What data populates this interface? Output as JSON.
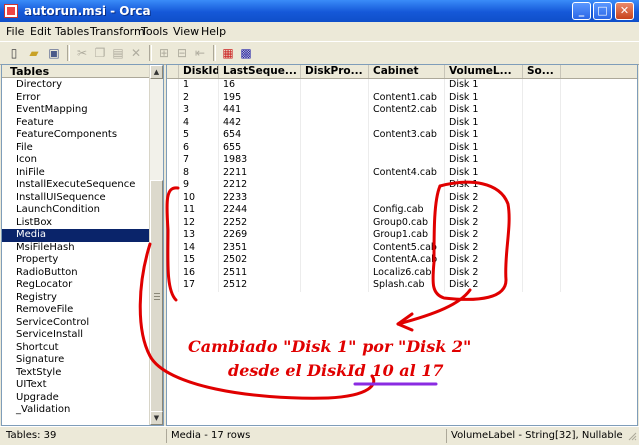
{
  "window": {
    "title": "autorun.msi - Orca"
  },
  "menu": [
    "File",
    "Edit",
    "Tables",
    "Transform",
    "Tools",
    "View",
    "Help"
  ],
  "toolbar_icons": [
    "new-icon",
    "open-icon",
    "save-icon",
    "cut-icon",
    "copy-icon",
    "paste-icon",
    "delete-icon",
    "add-row-icon",
    "drop-table-icon",
    "import-icon",
    "export-icon",
    "validate-icon",
    "merge-module-icon"
  ],
  "tables_pane": {
    "header": "Tables",
    "selected": "Media",
    "items": [
      "Directory",
      "Error",
      "EventMapping",
      "Feature",
      "FeatureComponents",
      "File",
      "Icon",
      "IniFile",
      "InstallExecuteSequence",
      "InstallUISequence",
      "LaunchCondition",
      "ListBox",
      "Media",
      "MsiFileHash",
      "Property",
      "RadioButton",
      "RegLocator",
      "Registry",
      "RemoveFile",
      "ServiceControl",
      "ServiceInstall",
      "Shortcut",
      "Signature",
      "TextStyle",
      "UIText",
      "Upgrade",
      "_Validation"
    ]
  },
  "grid": {
    "columns": [
      "DiskId",
      "LastSequence",
      "DiskPrompt",
      "Cabinet",
      "VolumeLabel",
      "Source"
    ],
    "columns_display": [
      "DiskId",
      "LastSeque...",
      "DiskPro...",
      "Cabinet",
      "VolumeL...",
      "So..."
    ],
    "rows": [
      [
        "1",
        "16",
        "",
        "",
        "Disk 1",
        ""
      ],
      [
        "2",
        "195",
        "",
        "Content1.cab",
        "Disk 1",
        ""
      ],
      [
        "3",
        "441",
        "",
        "Content2.cab",
        "Disk 1",
        ""
      ],
      [
        "4",
        "442",
        "",
        "",
        "Disk 1",
        ""
      ],
      [
        "5",
        "654",
        "",
        "Content3.cab",
        "Disk 1",
        ""
      ],
      [
        "6",
        "655",
        "",
        "",
        "Disk 1",
        ""
      ],
      [
        "7",
        "1983",
        "",
        "",
        "Disk 1",
        ""
      ],
      [
        "8",
        "2211",
        "",
        "Content4.cab",
        "Disk 1",
        ""
      ],
      [
        "9",
        "2212",
        "",
        "",
        "Disk 1",
        ""
      ],
      [
        "10",
        "2233",
        "",
        "",
        "Disk 2",
        ""
      ],
      [
        "11",
        "2244",
        "",
        "Config.cab",
        "Disk 2",
        ""
      ],
      [
        "12",
        "2252",
        "",
        "Group0.cab",
        "Disk 2",
        ""
      ],
      [
        "13",
        "2269",
        "",
        "Group1.cab",
        "Disk 2",
        ""
      ],
      [
        "14",
        "2351",
        "",
        "Content5.cab",
        "Disk 2",
        ""
      ],
      [
        "15",
        "2502",
        "",
        "ContentA.cab",
        "Disk 2",
        ""
      ],
      [
        "16",
        "2511",
        "",
        "Localiz6.cab",
        "Disk 2",
        ""
      ],
      [
        "17",
        "2512",
        "",
        "Splash.cab",
        "Disk 2",
        ""
      ]
    ]
  },
  "annotation": {
    "line1": "Cambiado \"Disk 1\" por \"Disk 2\"",
    "line2_prefix": "desde el DiskId ",
    "line2_highlight": "10 al 17",
    "color": "#e00000",
    "underline_color": "#8a2be2"
  },
  "status": {
    "tables_count": "Tables: 39",
    "current_table": "Media - 17 rows",
    "column_info": "VolumeLabel - String[32], Nullable"
  }
}
